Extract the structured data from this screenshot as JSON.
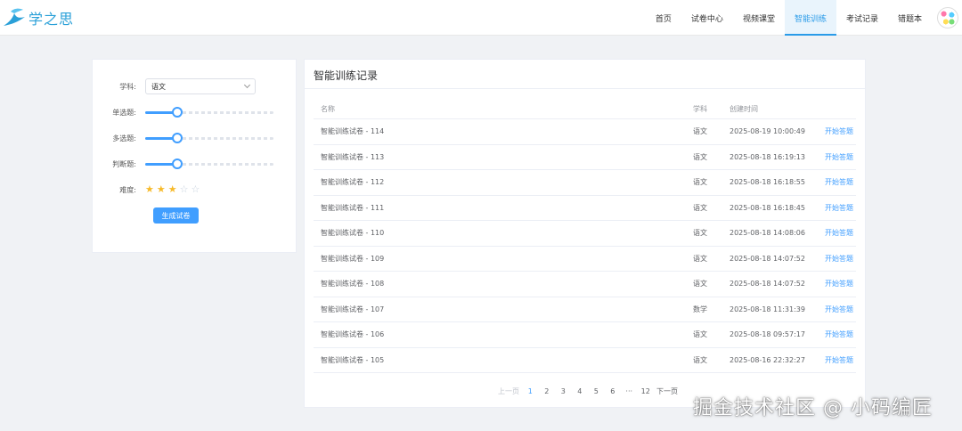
{
  "header": {
    "logo_text": "学之思",
    "nav": [
      "首页",
      "试卷中心",
      "视频课堂",
      "智能训练",
      "考试记录",
      "错题本"
    ],
    "active_index": 3
  },
  "form": {
    "subject_label": "学科:",
    "subject_value": "语文",
    "single_label": "单选题:",
    "single_level": 0.25,
    "multi_label": "多选题:",
    "multi_level": 0.25,
    "judge_label": "判断题:",
    "judge_level": 0.25,
    "difficulty_label": "难度:",
    "difficulty_stars": 3,
    "difficulty_max": 5,
    "generate_label": "生成试卷"
  },
  "records": {
    "title": "智能训练记录",
    "columns": {
      "name": "名称",
      "subject": "学科",
      "created": "创建时间"
    },
    "rows": [
      {
        "name": "智能训练试卷 - 114",
        "subject": "语文",
        "created": "2025-08-19 10:00:49",
        "action": "开始答题"
      },
      {
        "name": "智能训练试卷 - 113",
        "subject": "语文",
        "created": "2025-08-18 16:19:13",
        "action": "开始答题"
      },
      {
        "name": "智能训练试卷 - 112",
        "subject": "语文",
        "created": "2025-08-18 16:18:55",
        "action": "开始答题"
      },
      {
        "name": "智能训练试卷 - 111",
        "subject": "语文",
        "created": "2025-08-18 16:18:45",
        "action": "开始答题"
      },
      {
        "name": "智能训练试卷 - 110",
        "subject": "语文",
        "created": "2025-08-18 14:08:06",
        "action": "开始答题"
      },
      {
        "name": "智能训练试卷 - 109",
        "subject": "语文",
        "created": "2025-08-18 14:07:52",
        "action": "开始答题"
      },
      {
        "name": "智能训练试卷 - 108",
        "subject": "语文",
        "created": "2025-08-18 14:07:52",
        "action": "开始答题"
      },
      {
        "name": "智能训练试卷 - 107",
        "subject": "数学",
        "created": "2025-08-18 11:31:39",
        "action": "开始答题"
      },
      {
        "name": "智能训练试卷 - 106",
        "subject": "语文",
        "created": "2025-08-18 09:57:17",
        "action": "开始答题"
      },
      {
        "name": "智能训练试卷 - 105",
        "subject": "语文",
        "created": "2025-08-16 22:32:27",
        "action": "开始答题"
      }
    ]
  },
  "pagination": {
    "prev": "上一页",
    "pages": [
      "1",
      "2",
      "3",
      "4",
      "5",
      "6",
      "···",
      "12"
    ],
    "current": "1",
    "next": "下一页"
  },
  "watermark": "掘金技术社区 @ 小码编匠",
  "colors": {
    "accent": "#409eff",
    "brand": "#2aa0d8",
    "star": "#f7ba2a"
  }
}
